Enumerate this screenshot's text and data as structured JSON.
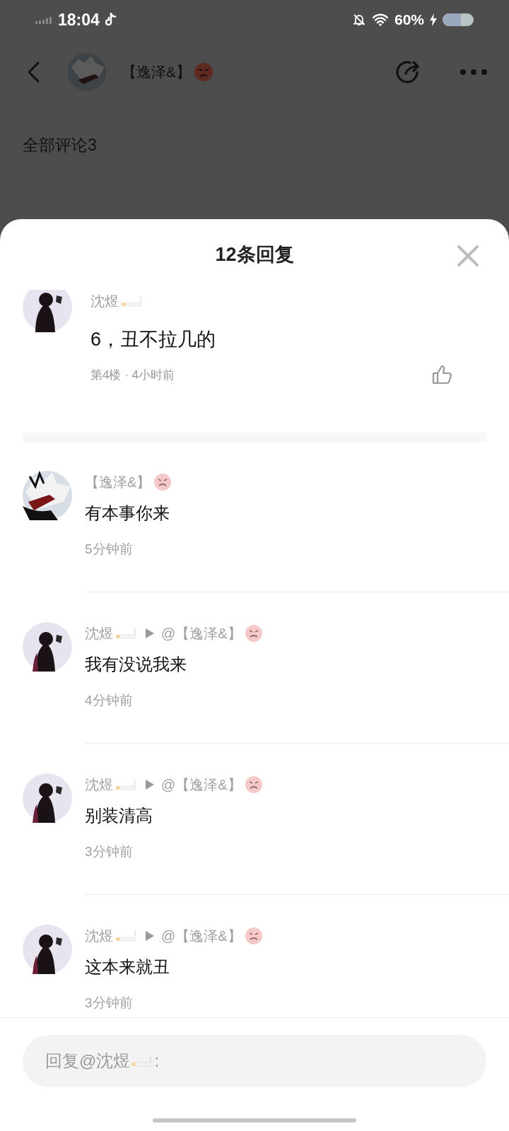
{
  "status_bar": {
    "time": "18:04",
    "battery": "60%"
  },
  "header": {
    "user_name": "【逸泽&】",
    "user_badge": {
      "kind": "angry"
    },
    "section_title": "全部评论3"
  },
  "sheet": {
    "title": "12条回复"
  },
  "main_comment": {
    "author": "沈煜",
    "author_badge": {
      "kind": "cigarette"
    },
    "text": "6，丑不拉几的",
    "meta": "第4楼 · 4小时前",
    "liked": false
  },
  "replies": [
    {
      "author": "【逸泽&】",
      "author_badge": {
        "kind": "angry"
      },
      "text": "有本事你来",
      "time": "5分钟前"
    },
    {
      "author": "沈煜",
      "author_badge": {
        "kind": "cigarette"
      },
      "target": "@【逸泽&】",
      "target_badge": {
        "kind": "angry"
      },
      "text": "我有没说我来",
      "time": "4分钟前"
    },
    {
      "author": "沈煜",
      "author_badge": {
        "kind": "cigarette"
      },
      "target": "@【逸泽&】",
      "target_badge": {
        "kind": "angry"
      },
      "text": "别装清高",
      "time": "3分钟前"
    },
    {
      "author": "沈煜",
      "author_badge": {
        "kind": "cigarette"
      },
      "target": "@【逸泽&】",
      "target_badge": {
        "kind": "angry"
      },
      "text": "这本来就丑",
      "time": "3分钟前"
    }
  ],
  "reply_box": {
    "prompt": "回复@沈煜",
    "prompt_badge": {
      "kind": "cigarette"
    },
    "prompt_end": ":"
  }
}
